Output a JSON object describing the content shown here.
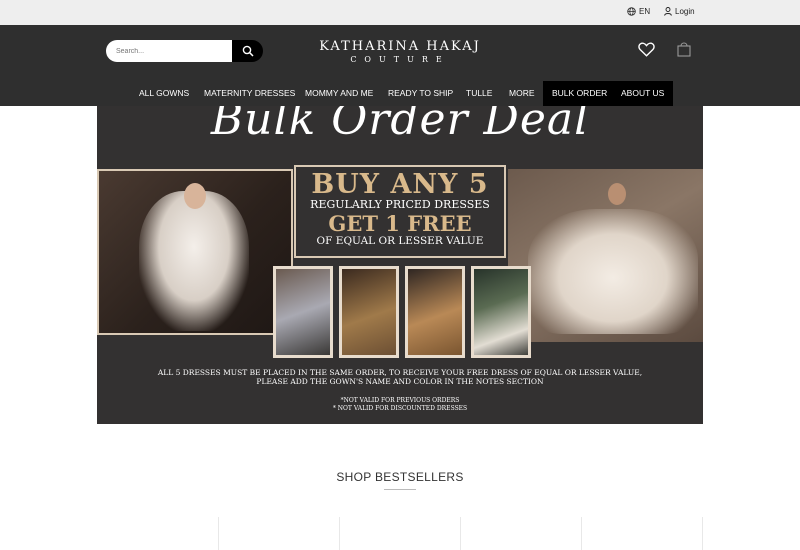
{
  "topbar": {
    "language": "EN",
    "login": "Login"
  },
  "search": {
    "placeholder": "Search..."
  },
  "brand": {
    "line1": "KATHARINA HAKAJ",
    "line2": "COUTURE"
  },
  "nav": {
    "items": [
      "ALL GOWNS",
      "MATERNITY DRESSES",
      "MOMMY AND ME",
      "READY TO SHIP",
      "TULLE",
      "MORE",
      "BULK ORDER",
      "ABOUT US"
    ]
  },
  "banner": {
    "headline": "Bulk Order Deal",
    "offer_line1": "BUY ANY 5",
    "offer_line2": "REGULARLY PRICED DRESSES",
    "offer_line3": "GET 1 FREE",
    "offer_line4": "OF EQUAL OR LESSER VALUE",
    "terms_line1": "ALL 5 DRESSES MUST BE PLACED IN THE SAME ORDER, TO RECEIVE YOUR FREE DRESS OF EQUAL OR LESSER VALUE,",
    "terms_line2": "PLEASE ADD THE GOWN'S NAME AND COLOR IN THE NOTES SECTION",
    "disclaimer1": "*NOT VALID FOR PREVIOUS ORDERS",
    "disclaimer2": "* NOT VALID FOR DISCOUNTED DRESSES"
  },
  "bestsellers": {
    "title": "SHOP BESTSELLERS"
  },
  "icons": [
    "globe-icon",
    "user-icon",
    "search-icon",
    "heart-icon",
    "shopping-bag-icon"
  ],
  "colors": {
    "header": "#2f2f2f",
    "topbar": "#eeeeee",
    "accent_gold": "#d9b98b",
    "banner_bg": "#333131"
  }
}
